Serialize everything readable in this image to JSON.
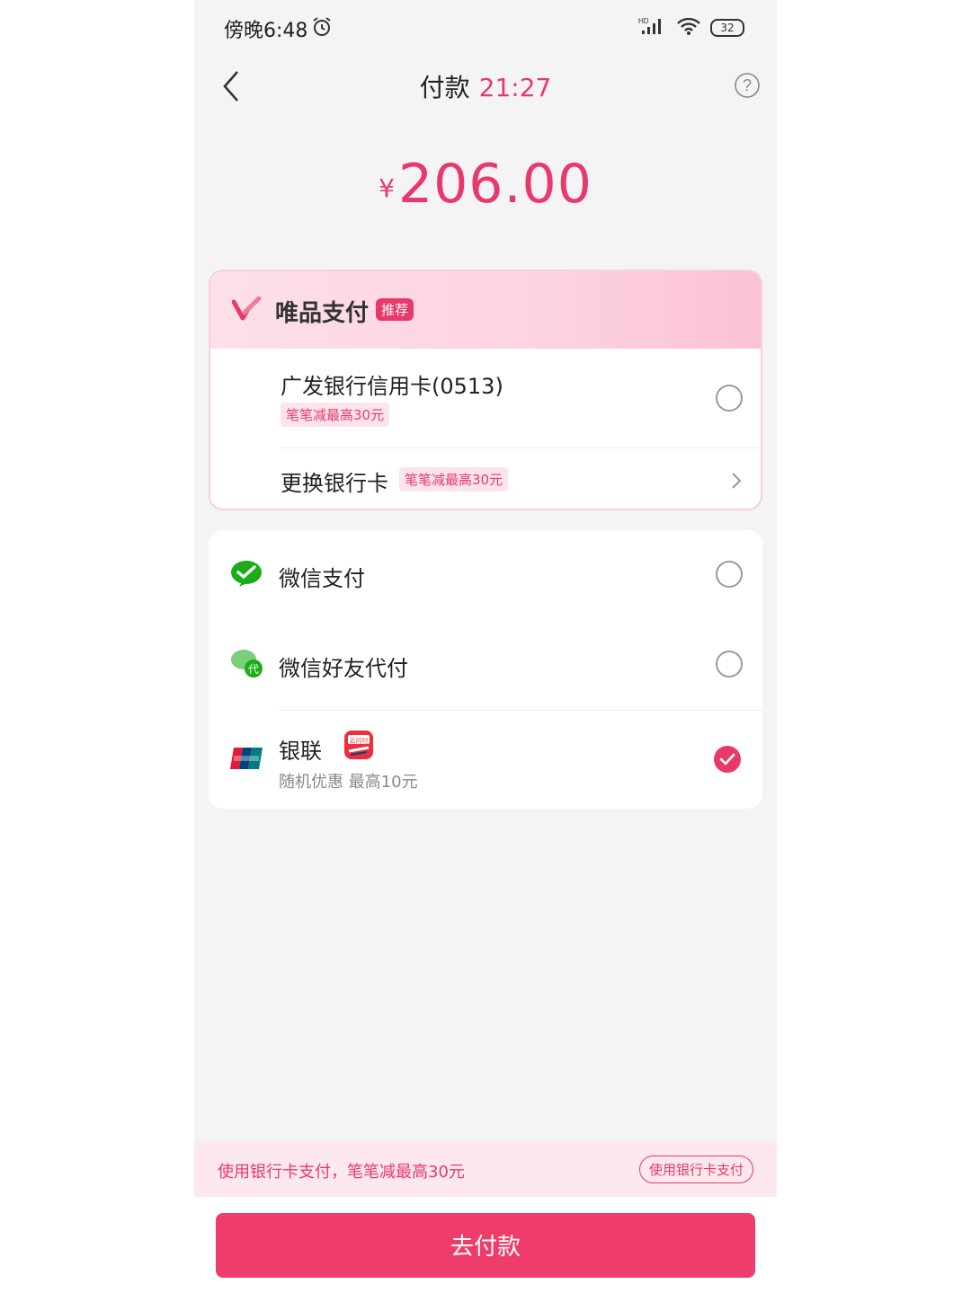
{
  "status_bar": {
    "time": "傍晚6:48",
    "battery": "32",
    "network": "HD"
  },
  "nav": {
    "title": "付款",
    "countdown": "21:27"
  },
  "amount": {
    "symbol": "¥",
    "value": "206.00"
  },
  "vip_pay": {
    "title": "唯品支付",
    "tag": "推荐",
    "card_name": "广发银行信用卡(0513)",
    "card_promo": "笔笔减最高30元",
    "change_label": "更换银行卡",
    "change_promo": "笔笔减最高30元"
  },
  "methods": [
    {
      "label": "微信支付",
      "icon": "wechat-pay-icon",
      "selected": false
    },
    {
      "label": "微信好友代付",
      "icon": "wechat-friend-pay-icon",
      "badge": "代",
      "selected": false
    },
    {
      "label": "银联",
      "icon": "unionpay-icon",
      "sub": "随机优惠 最高10元",
      "extra_icon": "yunshanfu-icon",
      "extra_text": "云闪付",
      "selected": true
    }
  ],
  "bank_bar": {
    "text": "使用银行卡支付，笔笔减最高30元",
    "button": "使用银行卡支付"
  },
  "pay_button": "去付款",
  "colors": {
    "accent": "#e8396a",
    "wechat": "#1aad19"
  }
}
